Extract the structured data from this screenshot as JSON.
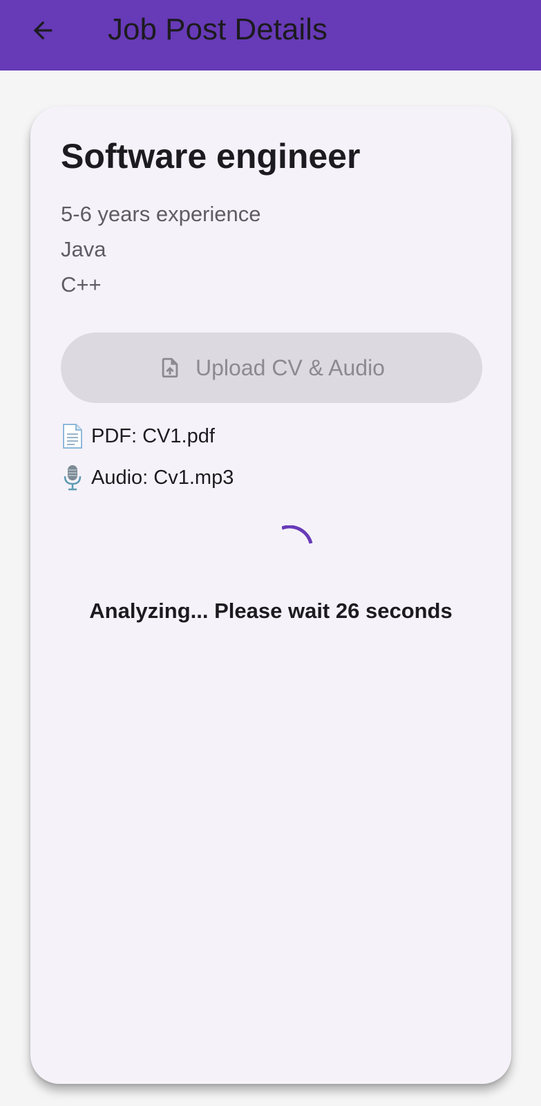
{
  "app_bar": {
    "title": "Job Post Details",
    "back_icon": "arrow-back-icon",
    "background": "#673ab7"
  },
  "job": {
    "title": "Software engineer",
    "requirements": [
      "5-6 years experience",
      "Java",
      "C++"
    ]
  },
  "upload_button": {
    "label": "Upload CV & Audio",
    "icon": "file-upload-icon",
    "state": "disabled"
  },
  "files": {
    "pdf": {
      "icon": "page-document-icon",
      "label": "PDF: CV1.pdf"
    },
    "audio": {
      "icon": "microphone-icon",
      "label": "Audio: Cv1.mp3"
    }
  },
  "status": {
    "spinner_icon": "loading-spinner-icon",
    "text": "Analyzing... Please wait 26 seconds"
  },
  "colors": {
    "accent": "#673ab7",
    "card_background": "#f5f2f9",
    "page_background": "#f5f5f6"
  }
}
